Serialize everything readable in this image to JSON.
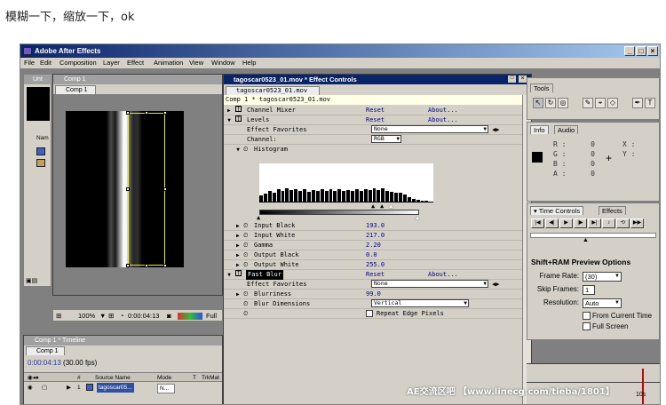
{
  "post_caption": "模糊一下，缩放一下，ok",
  "window": {
    "title": "Adobe After Effects",
    "min": "_",
    "max": "□",
    "close": "×"
  },
  "menu": [
    "File",
    "Edit",
    "Composition",
    "Layer",
    "Effect",
    "Animation",
    "View",
    "Window",
    "Help"
  ],
  "project_panel": {
    "tab": "Unt",
    "col_label": "Nam"
  },
  "comp_panel": {
    "title": "Comp 1",
    "tab": "Comp 1",
    "zoom": "100%",
    "timecode": "0:00:04:13",
    "resolution": "Full"
  },
  "effect_controls": {
    "title": "tagoscar0523_01.mov * Effect Controls",
    "tab": "tagoscar0523_01.mov",
    "subheader": "Comp 1 * tagoscar0523_01.mov",
    "rows": {
      "channel_mixer": {
        "name": "Channel Mixer",
        "reset": "Reset",
        "about": "About..."
      },
      "levels": {
        "name": "Levels",
        "reset": "Reset",
        "about": "About..."
      },
      "effect_favorites_1": {
        "name": "Effect Favorites",
        "value": "None"
      },
      "channel": {
        "name": "Channel:",
        "value": "RGB"
      },
      "histogram": {
        "name": "Histogram"
      },
      "input_black": {
        "name": "Input Black",
        "value": "193.0"
      },
      "input_white": {
        "name": "Input White",
        "value": "217.0"
      },
      "gamma": {
        "name": "Gamma",
        "value": "2.20"
      },
      "output_black": {
        "name": "Output Black",
        "value": "0.0"
      },
      "output_white": {
        "name": "Output White",
        "value": "255.0"
      },
      "fast_blur": {
        "name": "Fast Blur",
        "reset": "Reset",
        "about": "About..."
      },
      "effect_favorites_2": {
        "name": "Effect Favorites",
        "value": "None"
      },
      "blurriness": {
        "name": "Blurriness",
        "value": "99.0"
      },
      "blur_dimensions": {
        "name": "Blur Dimensions",
        "value": "Vertical"
      },
      "repeat_edge": {
        "name": "Repeat Edge Pixels"
      }
    }
  },
  "tools_panel": {
    "tab": "Tools"
  },
  "info_panel": {
    "tab_info": "Info",
    "tab_audio": "Audio",
    "r_label": "R :",
    "r_value": "0",
    "g_label": "G :",
    "g_value": "0",
    "b_label": "B :",
    "b_value": "0",
    "a_label": "A :",
    "a_value": "0",
    "x_label": "X :",
    "y_label": "Y :"
  },
  "time_controls": {
    "tab": "Time Controls",
    "tab_effects": "Effects",
    "preview_title": "Shift+RAM Preview Options",
    "frame_rate_label": "Frame Rate:",
    "frame_rate_value": "(30)",
    "skip_frames_label": "Skip Frames:",
    "skip_frames_value": "1",
    "resolution_label": "Resolution:",
    "resolution_value": "Auto",
    "from_current_time": "From Current Time",
    "full_screen": "Full Screen"
  },
  "timeline": {
    "title": "Comp 1 * Timeline",
    "tab": "Comp 1",
    "time": "0:00:04:13",
    "fps": "(30.00 fps)",
    "col_num": "#",
    "col_source": "Source Name",
    "col_mode": "Mode",
    "col_t": "T",
    "col_trk": "TrkMat",
    "layer_index": "1",
    "layer_name": "tagoscar05...",
    "layer_mode": "N...",
    "ruler_end": "10s"
  },
  "watermark": "AE交流区吧 【www.linecg.com/tieba/1801】",
  "colors": {
    "title_active": "#0a246a",
    "chrome": "#d4d0c8",
    "link": "#00008b"
  }
}
